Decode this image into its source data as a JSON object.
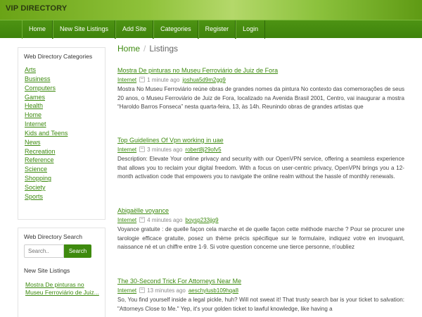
{
  "site_title": "VIP DIRECTORY",
  "nav": [
    "Home",
    "New Site Listings",
    "Add Site",
    "Categories",
    "Register",
    "Login"
  ],
  "sidebar": {
    "categories_title": "Web Directory Categories",
    "categories": [
      "Arts",
      "Business",
      "Computers",
      "Games",
      "Health",
      "Home",
      "Internet",
      "Kids and Teens",
      "News",
      "Recreation",
      "Reference",
      "Science",
      "Shopping",
      "Society",
      "Sports"
    ],
    "search_title": "Web Directory Search",
    "search_placeholder": "Search..",
    "search_button": "Search",
    "new_listings_title": "New Site Listings",
    "new_listings": [
      "Mostra De pinturas no Museu Ferroviário de Juiz..."
    ]
  },
  "breadcrumb": {
    "home": "Home",
    "separator": "/",
    "current": "Listings"
  },
  "listings": [
    {
      "title": "Mostra De pinturas no Museu Ferroviário de Juiz de Fora",
      "category": "Internet",
      "time": "1 minute ago",
      "user": "joshua5d9m2gg9",
      "description": "Mostra No Museu Ferroviário reúne obras de grandes nomes da pintura No contexto das comemorações de seus 20 anos, o Museu Ferroviário de Juiz de Fora, localizado na Avenida Brasil 2001, Centro, vai inaugurar a mostra “Haroldo Barros Fonseca” nesta quarta-feira, 13, às 14h. Reunindo obras de grandes artistas que"
    },
    {
      "title": "Top Guidelines Of Vpn working in uae",
      "category": "Internet",
      "time": "3 minutes ago",
      "user": "robert8j29ofv5",
      "description": "Description: Elevate Your online privacy and security with our OpenVPN service, offering a seamless experience that allows you to reclaim your digital freedom. With a focus on user-centric privacy, OpenVPN brings you a 12-month activation code that empowers you to navigate the online realm without the hassle of monthly renewals."
    },
    {
      "title": "Abigaëlle voyance",
      "category": "Internet",
      "time": "4 minutes ago",
      "user": "boysp233jjq9",
      "description": "Voyance gratuite : de quelle façon cela marche et de quelle façon cette méthode marche ? Pour se procurer une tarologie efficace gratuite, posez un thème précis spécifique sur le formulaire, indiquez votre en invoquant, naissance né et un chiffre entre 1-9. Si votre question concerne une tierce personne, n'oubliez"
    },
    {
      "title": "The 30-Second Trick For Attorneys Near Me",
      "category": "Internet",
      "time": "13 minutes ago",
      "user": "aeschylusb109hqa8",
      "description": "So, You find yourself inside a legal pickle, huh? Will not sweat it! That trusty search bar is your ticket to salvation: \"Attorneys Close to Me.\" Yep, it's your golden ticket to lawful knowledge, like having a"
    }
  ],
  "colors": {
    "accent_green": "#3d8a0f",
    "nav_green": "#3f830c"
  }
}
